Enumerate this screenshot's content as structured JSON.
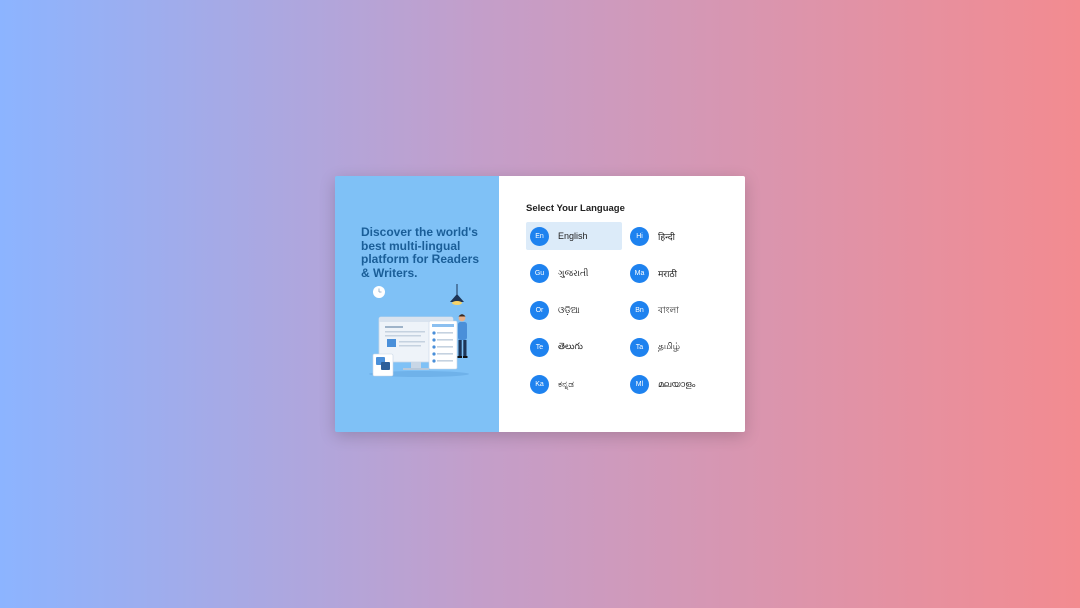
{
  "left": {
    "tagline": "Discover the world's best multi-lingual platform for Readers & Writers."
  },
  "right": {
    "title": "Select Your Language",
    "selected": "en",
    "languages": [
      {
        "code": "en",
        "badge": "En",
        "name": "English"
      },
      {
        "code": "hi",
        "badge": "Hi",
        "name": "हिन्दी"
      },
      {
        "code": "gu",
        "badge": "Gu",
        "name": "ગુજરાતી"
      },
      {
        "code": "mr",
        "badge": "Ma",
        "name": "मराठी"
      },
      {
        "code": "or",
        "badge": "Or",
        "name": "ଓଡ଼ିଆ"
      },
      {
        "code": "bn",
        "badge": "Bn",
        "name": "বাংলা"
      },
      {
        "code": "te",
        "badge": "Te",
        "name": "తెలుగు"
      },
      {
        "code": "ta",
        "badge": "Ta",
        "name": "தமிழ்"
      },
      {
        "code": "kn",
        "badge": "Ka",
        "name": "ಕನ್ನಡ"
      },
      {
        "code": "ml",
        "badge": "Ml",
        "name": "മലയാളം"
      }
    ]
  },
  "colors": {
    "accent": "#1e82ef",
    "left_panel": "#7fc1f6",
    "tagline": "#1a5e98",
    "selected_bg": "#dcebf9"
  }
}
